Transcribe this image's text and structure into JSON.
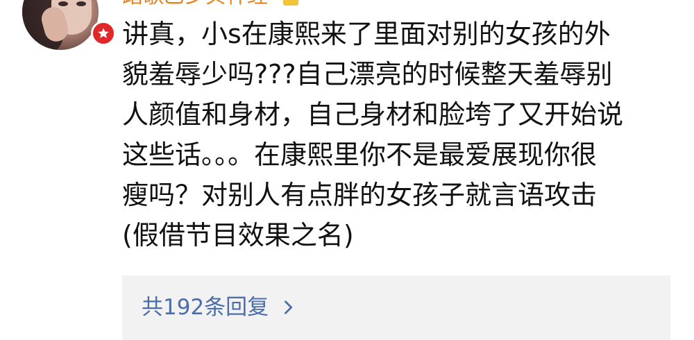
{
  "comment": {
    "author": {
      "name": "踏歌乙乡贝神经",
      "avatar_icon": "avatar",
      "badge_icon": "vip-badge-icon",
      "badge_color": "#e0282b",
      "name_color": "#e6821e"
    },
    "text_lines": [
      "讲真，小s在康熙来了里面对别的女孩的外",
      "貌羞辱少吗???自己漂亮的时候整天羞辱别",
      "人颜值和身材，自己身材和脸垮了又开始说",
      "这些话。。。在康熙里你不是最爱展现你很",
      "瘦吗？对别人有点胖的女孩子就言语攻击",
      "(假借节目效果之名)"
    ],
    "replies": {
      "label": "共192条回复",
      "icon": "chevron-right-icon",
      "link_color": "#4b6ea8",
      "background": "#f2f2f2"
    }
  }
}
